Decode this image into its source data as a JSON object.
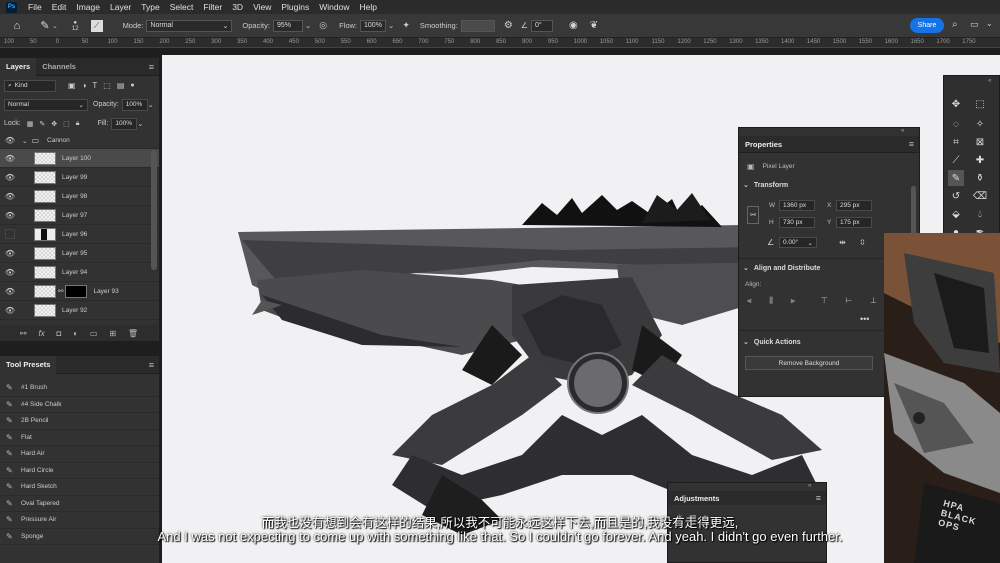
{
  "menu": [
    "File",
    "Edit",
    "Image",
    "Layer",
    "Type",
    "Select",
    "Filter",
    "3D",
    "View",
    "Plugins",
    "Window",
    "Help"
  ],
  "options": {
    "brush_size": "12",
    "mode_label": "Mode:",
    "mode_value": "Normal",
    "opacity_label": "Opacity:",
    "opacity_value": "95%",
    "flow_label": "Flow:",
    "flow_value": "100%",
    "smoothing_label": "Smoothing:",
    "angle_value": "0°",
    "share_label": "Share"
  },
  "ruler": [
    "100",
    "50",
    "0",
    "50",
    "100",
    "150",
    "200",
    "250",
    "300",
    "350",
    "400",
    "450",
    "500",
    "550",
    "600",
    "650",
    "700",
    "750",
    "800",
    "850",
    "900",
    "950",
    "1000",
    "1050",
    "1100",
    "1150",
    "1200",
    "1250",
    "1300",
    "1350",
    "1400",
    "1450",
    "1500",
    "1550",
    "1600",
    "1650",
    "1700",
    "1750"
  ],
  "layers_panel": {
    "tabs": [
      "Layers",
      "Channels"
    ],
    "filter_kind": "Kind",
    "blend_mode": "Normal",
    "opacity_label": "Opacity:",
    "opacity_value": "100%",
    "lock_label": "Lock:",
    "fill_label": "Fill:",
    "fill_value": "100%",
    "group_name": "Cannon",
    "layers": [
      {
        "name": "Layer 100",
        "visible": true,
        "selected": true
      },
      {
        "name": "Layer 99",
        "visible": true,
        "selected": false
      },
      {
        "name": "Layer 98",
        "visible": true,
        "selected": false
      },
      {
        "name": "Layer 97",
        "visible": true,
        "selected": false
      },
      {
        "name": "Layer 96",
        "visible": false,
        "selected": false
      },
      {
        "name": "Layer 95",
        "visible": true,
        "selected": false
      },
      {
        "name": "Layer 94",
        "visible": true,
        "selected": false
      },
      {
        "name": "Layer 93",
        "visible": true,
        "selected": false
      },
      {
        "name": "Layer 92",
        "visible": true,
        "selected": false
      }
    ]
  },
  "tool_presets": {
    "title": "Tool Presets",
    "items": [
      "#1 Brush",
      "#4 Side Chalk",
      "2B Pencil",
      "Flat",
      "Hard Air",
      "Hard Circle",
      "Hard Sketch",
      "Oval Tapered",
      "Pressure Air",
      "Sponge"
    ]
  },
  "properties": {
    "title": "Properties",
    "layer_type": "Pixel Layer",
    "transform_title": "Transform",
    "w_label": "W",
    "w_value": "1360 px",
    "h_label": "H",
    "h_value": "730 px",
    "x_label": "X",
    "x_value": "295 px",
    "y_label": "Y",
    "y_value": "175 px",
    "angle_value": "0.00°",
    "align_title": "Align and Distribute",
    "align_label": "Align:",
    "quick_actions_title": "Quick Actions",
    "remove_bg_label": "Remove Background"
  },
  "adjustments": {
    "title": "Adjustments"
  },
  "subtitles": {
    "cn": "而我也没有想到会有这样的结果,所以我不可能永远这样下去,而且是的,我没有走得更远,",
    "en": "And I was not expecting to come up with something like that. So I couldn't go forever. And yeah. I didn't go even further."
  },
  "photo_text": "HPA BLACK OPS",
  "colors": {
    "accent": "#1473e6",
    "panel": "#323232",
    "canvas": "#f1f0f2"
  }
}
